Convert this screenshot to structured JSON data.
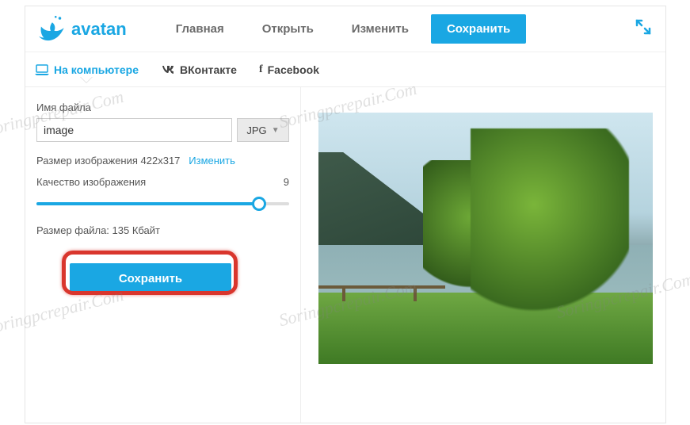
{
  "brand": "avatan",
  "nav": {
    "home": "Главная",
    "open": "Открыть",
    "edit": "Изменить",
    "save": "Сохранить"
  },
  "subtabs": {
    "computer": "На компьютере",
    "vk": "ВКонтакте",
    "facebook": "Facebook"
  },
  "panel": {
    "filename_label": "Имя файла",
    "filename_value": "image",
    "format": "JPG",
    "dim_prefix": "Размер изображения ",
    "dim_value": "422x317",
    "dim_change": "Изменить",
    "quality_label": "Качество изображения",
    "quality_value": "9",
    "filesize_prefix": "Размер файла: ",
    "filesize_value": "135 Кбайт",
    "save_button": "Сохранить"
  },
  "watermark": "Soringpcrepair.Com"
}
